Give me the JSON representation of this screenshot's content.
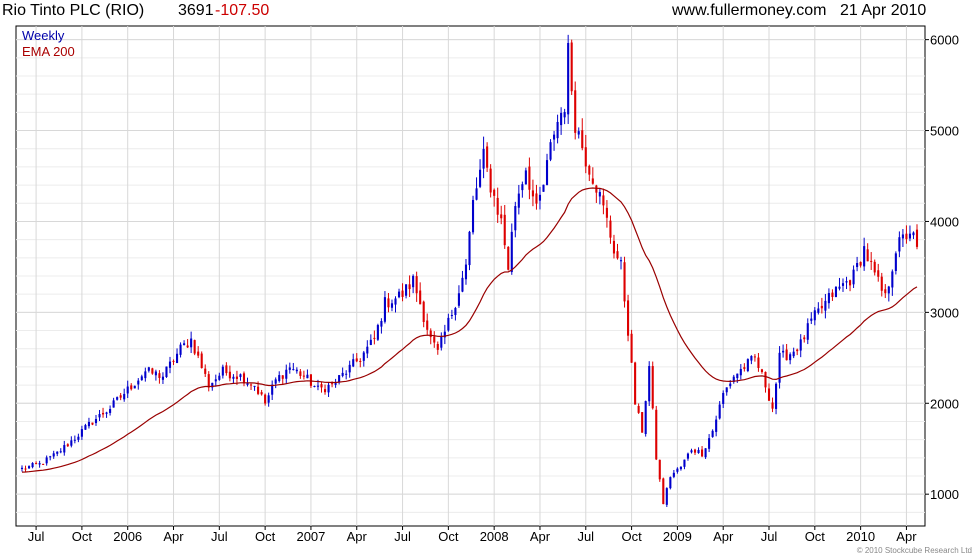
{
  "header": {
    "instrument": "Rio Tinto PLC (RIO)",
    "price": "3691",
    "change": "-107.50",
    "site": "www.fullermoney.com",
    "date": "21 Apr 2010"
  },
  "legend": {
    "weekly": "Weekly",
    "ema": "EMA 200"
  },
  "copyright": "© 2010 Stockcube Research Ltd",
  "colors": {
    "up": "#0000cc",
    "down": "#dd0000",
    "ema": "#990000",
    "grid": "#d8d8d8",
    "axis": "#000000",
    "change_text": "#cc0000"
  },
  "chart_data": {
    "type": "candlestick",
    "title": "Rio Tinto PLC (RIO)",
    "frequency": "Weekly",
    "ylim": [
      650,
      6150
    ],
    "y_ticks": [
      1000,
      2000,
      3000,
      4000,
      5000,
      6000
    ],
    "x_ticks": [
      {
        "label": "Jul",
        "week": 4
      },
      {
        "label": "Oct",
        "week": 17
      },
      {
        "label": "2006",
        "week": 30
      },
      {
        "label": "Apr",
        "week": 43
      },
      {
        "label": "Jul",
        "week": 56
      },
      {
        "label": "Oct",
        "week": 69
      },
      {
        "label": "2007",
        "week": 82
      },
      {
        "label": "Apr",
        "week": 95
      },
      {
        "label": "Jul",
        "week": 108
      },
      {
        "label": "Oct",
        "week": 121
      },
      {
        "label": "2008",
        "week": 134
      },
      {
        "label": "Apr",
        "week": 147
      },
      {
        "label": "Jul",
        "week": 160
      },
      {
        "label": "Oct",
        "week": 173
      },
      {
        "label": "2009",
        "week": 186
      },
      {
        "label": "Apr",
        "week": 199
      },
      {
        "label": "Jul",
        "week": 212
      },
      {
        "label": "Oct",
        "week": 225
      },
      {
        "label": "2010",
        "week": 238
      },
      {
        "label": "Apr",
        "week": 251
      }
    ],
    "weeks": 255,
    "anchors": [
      [
        0,
        1280
      ],
      [
        5,
        1330
      ],
      [
        10,
        1450
      ],
      [
        15,
        1620
      ],
      [
        20,
        1800
      ],
      [
        25,
        1950
      ],
      [
        30,
        2150
      ],
      [
        35,
        2350
      ],
      [
        40,
        2300
      ],
      [
        45,
        2600
      ],
      [
        48,
        2700
      ],
      [
        50,
        2500
      ],
      [
        53,
        2200
      ],
      [
        57,
        2350
      ],
      [
        62,
        2300
      ],
      [
        66,
        2200
      ],
      [
        69,
        2000
      ],
      [
        72,
        2250
      ],
      [
        76,
        2400
      ],
      [
        80,
        2300
      ],
      [
        84,
        2150
      ],
      [
        88,
        2200
      ],
      [
        92,
        2350
      ],
      [
        96,
        2500
      ],
      [
        100,
        2700
      ],
      [
        103,
        3100
      ],
      [
        108,
        3200
      ],
      [
        111,
        3350
      ],
      [
        113,
        3100
      ],
      [
        116,
        2700
      ],
      [
        118,
        2550
      ],
      [
        122,
        3000
      ],
      [
        126,
        3500
      ],
      [
        128,
        4200
      ],
      [
        131,
        4700
      ],
      [
        133,
        4400
      ],
      [
        136,
        4000
      ],
      [
        138,
        3500
      ],
      [
        140,
        4200
      ],
      [
        143,
        4600
      ],
      [
        146,
        4100
      ],
      [
        148,
        4400
      ],
      [
        151,
        5000
      ],
      [
        154,
        5300
      ],
      [
        155,
        5850
      ],
      [
        157,
        5100
      ],
      [
        160,
        4700
      ],
      [
        163,
        4400
      ],
      [
        166,
        4000
      ],
      [
        168,
        3700
      ],
      [
        170,
        3500
      ],
      [
        172,
        2800
      ],
      [
        174,
        2000
      ],
      [
        176,
        1700
      ],
      [
        178,
        2400
      ],
      [
        180,
        1400
      ],
      [
        182,
        900
      ],
      [
        184,
        1200
      ],
      [
        187,
        1300
      ],
      [
        190,
        1500
      ],
      [
        193,
        1450
      ],
      [
        196,
        1700
      ],
      [
        199,
        2100
      ],
      [
        202,
        2300
      ],
      [
        205,
        2400
      ],
      [
        208,
        2500
      ],
      [
        211,
        2200
      ],
      [
        213,
        1950
      ],
      [
        215,
        2500
      ],
      [
        218,
        2550
      ],
      [
        221,
        2650
      ],
      [
        224,
        2900
      ],
      [
        227,
        3050
      ],
      [
        230,
        3200
      ],
      [
        233,
        3300
      ],
      [
        236,
        3400
      ],
      [
        239,
        3700
      ],
      [
        242,
        3400
      ],
      [
        245,
        3150
      ],
      [
        248,
        3700
      ],
      [
        252,
        3900
      ],
      [
        254,
        3720
      ]
    ]
  }
}
